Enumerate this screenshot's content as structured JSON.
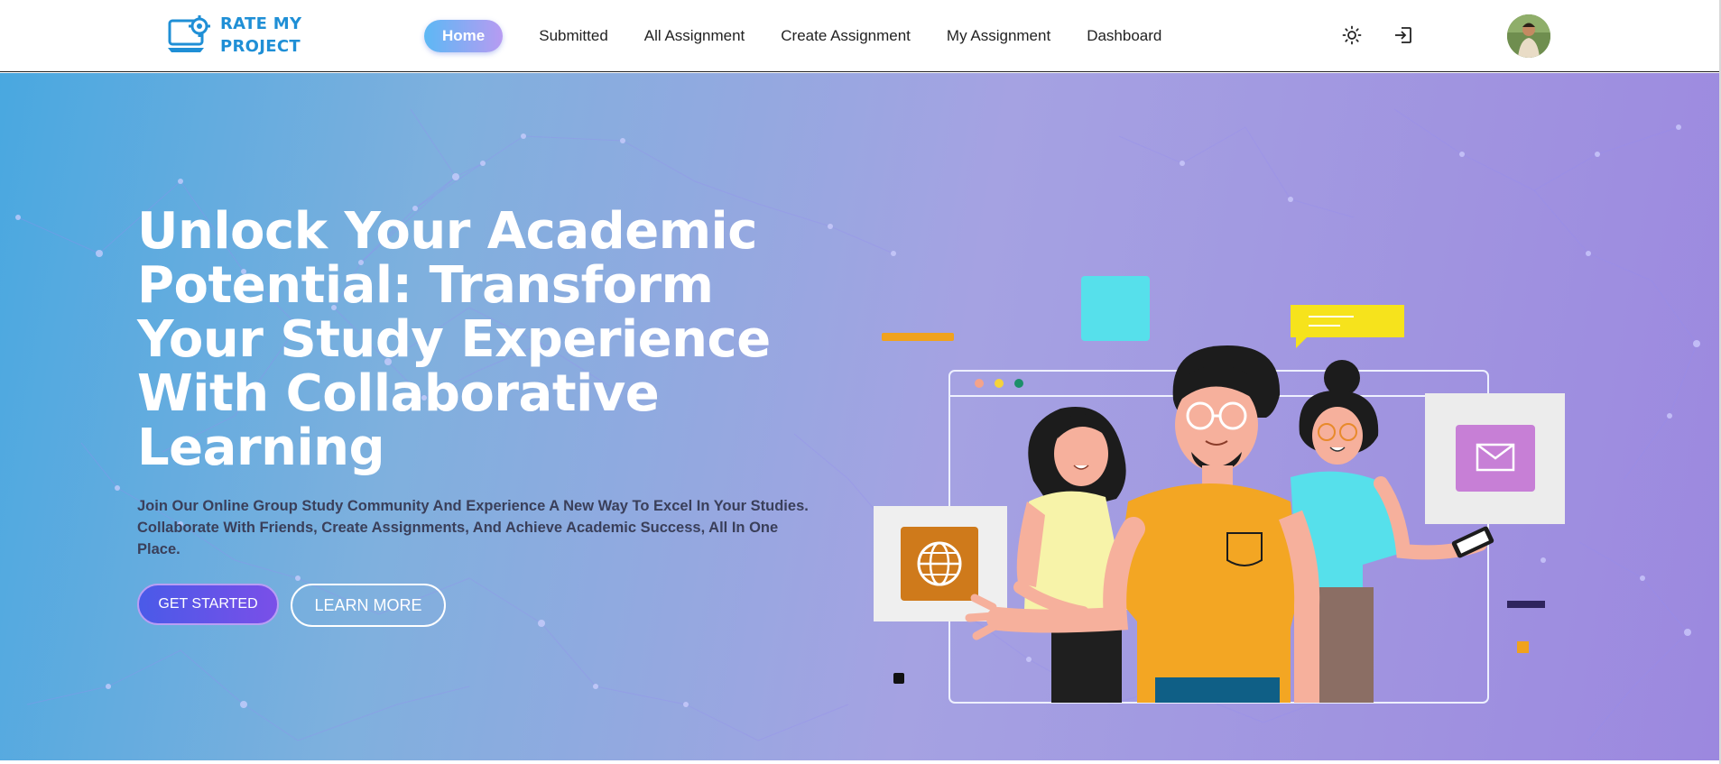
{
  "brand": {
    "line1": "RATE MY",
    "line2": "PROJECT"
  },
  "nav": {
    "items": [
      {
        "label": "Home",
        "active": true
      },
      {
        "label": "Submitted",
        "active": false
      },
      {
        "label": "All Assignment",
        "active": false
      },
      {
        "label": "Create Assignment",
        "active": false
      },
      {
        "label": "My Assignment",
        "active": false
      },
      {
        "label": "Dashboard",
        "active": false
      }
    ],
    "icons": [
      "theme-toggle-sun-icon",
      "logout-icon"
    ]
  },
  "hero": {
    "headline": "Unlock Your Academic Potential: Transform Your Study Experience With Collaborative Learning",
    "subtext": "Join Our Online Group Study Community And Experience A New Way To Excel In Your Studies. Collaborate With Friends, Create Assignments, And Achieve Academic Success, All In One Place.",
    "primary_button": "GET STARTED",
    "secondary_button": "LEARN MORE"
  },
  "colors": {
    "brand_blue": "#1f8fd6",
    "hero_start": "#49a8e0",
    "hero_end": "#9c88df",
    "active_tab": "#5cb8f4"
  }
}
